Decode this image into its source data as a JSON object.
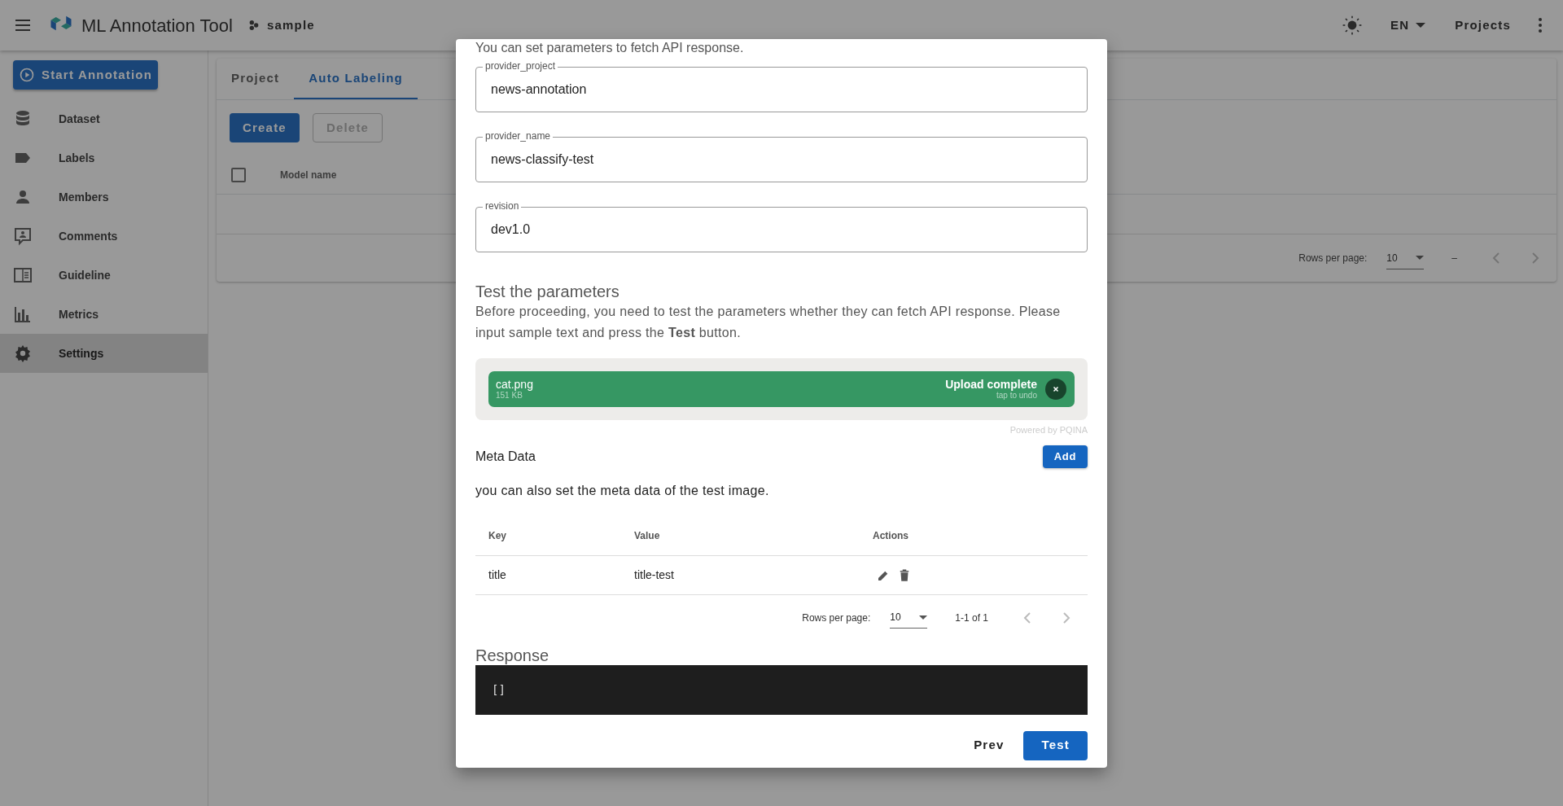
{
  "app_bar": {
    "title": "ML Annotation Tool",
    "project": "sample",
    "language": "EN",
    "projects_link": "Projects"
  },
  "sidebar": {
    "start_button": "Start Annotation",
    "items": [
      {
        "label": "Dataset",
        "kind": "dataset",
        "selected": false
      },
      {
        "label": "Labels",
        "kind": "label",
        "selected": false
      },
      {
        "label": "Members",
        "kind": "person",
        "selected": false
      },
      {
        "label": "Comments",
        "kind": "comment",
        "selected": false
      },
      {
        "label": "Guideline",
        "kind": "guideline",
        "selected": false
      },
      {
        "label": "Metrics",
        "kind": "metrics",
        "selected": false
      },
      {
        "label": "Settings",
        "kind": "settings",
        "selected": true
      }
    ]
  },
  "page": {
    "tabs": [
      {
        "label": "Project",
        "selected": false
      },
      {
        "label": "Auto Labeling",
        "selected": true
      }
    ],
    "buttons": [
      {
        "label": "Create",
        "disabled": false
      },
      {
        "label": "Delete",
        "disabled": true
      }
    ],
    "table": {
      "all_checked": false,
      "columns": [
        "Model name"
      ],
      "footer": {
        "rows_per_page_label": "Rows per page:",
        "rows_per_page": "10",
        "range": "–"
      }
    }
  },
  "dialog": {
    "intro": "You can set parameters to fetch API response.",
    "fields": [
      {
        "label": "provider_project",
        "value": "news-annotation"
      },
      {
        "label": "provider_name",
        "value": "news-classify-test"
      },
      {
        "label": "revision",
        "value": "dev1.0"
      }
    ],
    "test_heading": "Test the parameters",
    "test_text": "Before proceeding, you need to test the parameters whether they can fetch API response. Please input sample text and press the **Test** button.",
    "upload": {
      "file_name": "cat.png",
      "file_size": "151 KB",
      "status": "Upload complete",
      "hint": "tap to undo",
      "credit": "Powered by PQINA"
    },
    "meta_data": {
      "title": "Meta Data",
      "add_button": "Add",
      "description": "you can also set the meta data of the test image.",
      "columns": [
        "Key",
        "Value",
        "Actions"
      ],
      "rows": [
        {
          "key": "title",
          "value": "title-test"
        }
      ],
      "footer": {
        "rows_per_page_label": "Rows per page:",
        "rows_per_page": "10",
        "range": "1-1 of 1"
      }
    },
    "response": {
      "title": "Response",
      "body": "[]"
    },
    "actions": [
      {
        "label": "Prev",
        "kind": "text"
      },
      {
        "label": "Test",
        "kind": "primary"
      }
    ]
  }
}
